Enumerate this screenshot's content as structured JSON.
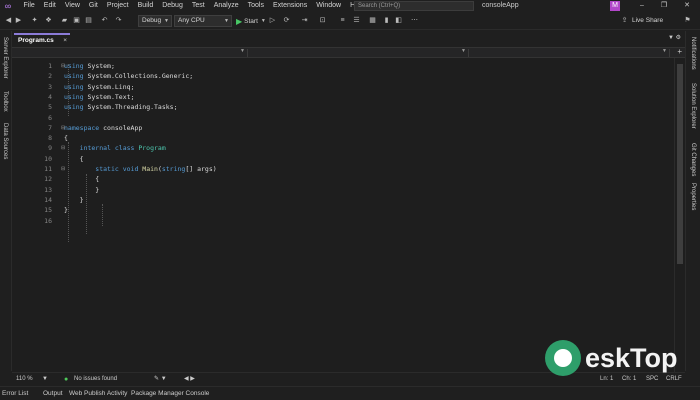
{
  "menu": {
    "items": [
      "File",
      "Edit",
      "View",
      "Git",
      "Project",
      "Build",
      "Debug",
      "Test",
      "Analyze",
      "Tools",
      "Extensions",
      "Window",
      "Help"
    ],
    "search_placeholder": "Search (Ctrl+Q)",
    "window_title": "consoleApp",
    "avatar_initial": "M",
    "minimize": "–",
    "restore": "❐",
    "close": "✕"
  },
  "toolbar": {
    "config": "Debug",
    "platform": "Any CPU",
    "start_label": "Start",
    "live_share": "Live Share"
  },
  "left_panels": [
    "Server Explorer",
    "Toolbox",
    "Data Sources"
  ],
  "right_panels": [
    "Notifications",
    "Solution Explorer",
    "Git Changes",
    "Properties"
  ],
  "document": {
    "tab_label": "Program.cs",
    "tab_close": "×"
  },
  "code": {
    "lines": [
      {
        "n": "1",
        "tokens": [
          {
            "t": "using",
            "c": "kw"
          },
          {
            "t": " System;",
            "c": ""
          }
        ]
      },
      {
        "n": "2",
        "tokens": [
          {
            "t": "using",
            "c": "kw"
          },
          {
            "t": " System.Collections.Generic;",
            "c": ""
          }
        ]
      },
      {
        "n": "3",
        "tokens": [
          {
            "t": "using",
            "c": "kw"
          },
          {
            "t": " System.Linq;",
            "c": ""
          }
        ]
      },
      {
        "n": "4",
        "tokens": [
          {
            "t": "using",
            "c": "kw"
          },
          {
            "t": " System.Text;",
            "c": ""
          }
        ]
      },
      {
        "n": "5",
        "tokens": [
          {
            "t": "using",
            "c": "kw"
          },
          {
            "t": " System.Threading.Tasks;",
            "c": ""
          }
        ]
      },
      {
        "n": "6",
        "tokens": []
      },
      {
        "n": "7",
        "tokens": [
          {
            "t": "namespace",
            "c": "kw"
          },
          {
            "t": " consoleApp",
            "c": ""
          }
        ]
      },
      {
        "n": "8",
        "tokens": [
          {
            "t": "{",
            "c": ""
          }
        ]
      },
      {
        "n": "9",
        "tokens": [
          {
            "t": "    internal class ",
            "c": "kw"
          },
          {
            "t": "Program",
            "c": "cls"
          }
        ]
      },
      {
        "n": "10",
        "tokens": [
          {
            "t": "    {",
            "c": ""
          }
        ]
      },
      {
        "n": "11",
        "tokens": [
          {
            "t": "        static void ",
            "c": "kw"
          },
          {
            "t": "Main",
            "c": "fn"
          },
          {
            "t": "(",
            "c": ""
          },
          {
            "t": "string",
            "c": "kw"
          },
          {
            "t": "[] args)",
            "c": ""
          }
        ]
      },
      {
        "n": "12",
        "tokens": [
          {
            "t": "        {",
            "c": ""
          }
        ]
      },
      {
        "n": "13",
        "tokens": [
          {
            "t": "        }",
            "c": ""
          }
        ]
      },
      {
        "n": "14",
        "tokens": [
          {
            "t": "    }",
            "c": ""
          }
        ]
      },
      {
        "n": "15",
        "tokens": [
          {
            "t": "}",
            "c": ""
          }
        ]
      },
      {
        "n": "16",
        "tokens": []
      }
    ]
  },
  "status": {
    "zoom": "110 %",
    "issues": "No issues found",
    "line": "Ln: 1",
    "col": "Ch: 1",
    "spaces": "SPC",
    "eol": "CRLF"
  },
  "bottom_tabs": [
    "Error List",
    "Output",
    "Web Publish Activity",
    "Package Manager Console"
  ],
  "watermark": {
    "text": "eskTop"
  },
  "colors": {
    "accent": "#8b7bd8",
    "keyword": "#569cd6",
    "class": "#4ec9b0",
    "method": "#dcdcaa",
    "ok": "#4ec95a"
  }
}
